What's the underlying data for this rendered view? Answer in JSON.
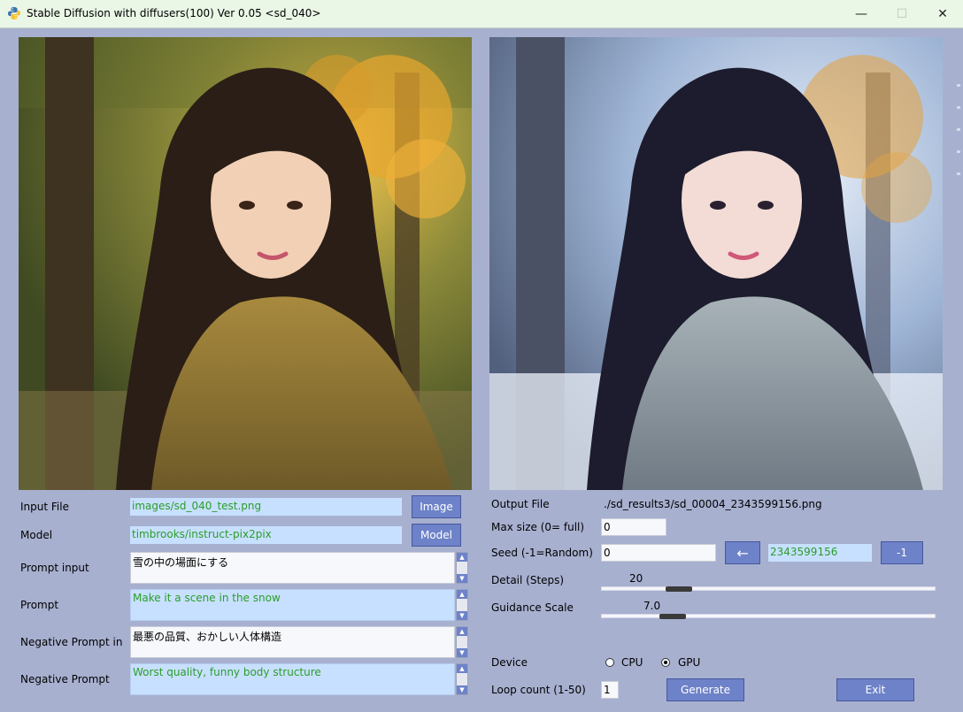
{
  "window": {
    "title": "Stable Diffusion with diffusers(100)  Ver 0.05 <sd_040>",
    "minimize_label": "—",
    "maximize_label": "☐",
    "close_label": "✕"
  },
  "images": {
    "input_alt": "input image",
    "output_alt": "output image"
  },
  "left": {
    "input_file_label": "Input File",
    "input_file_value": "images/sd_040_test.png",
    "image_button": "Image",
    "model_label": "Model",
    "model_value": "timbrooks/instruct-pix2pix",
    "model_button": "Model",
    "prompt_input_label": "Prompt input",
    "prompt_input_value": "雪の中の場面にする",
    "prompt_label": "Prompt",
    "prompt_value": "Make it a scene in the snow",
    "neg_prompt_input_label": "Negative Prompt in",
    "neg_prompt_input_value": "最悪の品質、おかしい人体構造",
    "neg_prompt_label": "Negative Prompt",
    "neg_prompt_value": "Worst quality, funny body structure"
  },
  "right": {
    "output_file_label": "Output File",
    "output_file_value": "./sd_results3/sd_00004_2343599156.png",
    "max_size_label": "Max size (0= full)",
    "max_size_value": "0",
    "seed_label": "Seed  (-1=Random)",
    "seed_value": "0",
    "seed_arrow_button": "←",
    "seed_result": "2343599156",
    "seed_minus_button": "-1",
    "detail_label": "Detail (Steps)",
    "detail_value": "20",
    "detail_fraction": 0.17,
    "guidance_label": "Guidance Scale",
    "guidance_value": "7.0",
    "guidance_fraction": 0.15,
    "device_label": "Device",
    "cpu_label": "CPU",
    "gpu_label": "GPU",
    "device_selected": "GPU",
    "loop_label": "Loop count (1-50)",
    "loop_value": "1",
    "generate_button": "Generate",
    "exit_button": "Exit"
  },
  "colors": {
    "background": "#a8b0d0",
    "button": "#6d82c8",
    "field_blue": "#c8e0ff",
    "field_text_green": "#2a9d2a"
  }
}
